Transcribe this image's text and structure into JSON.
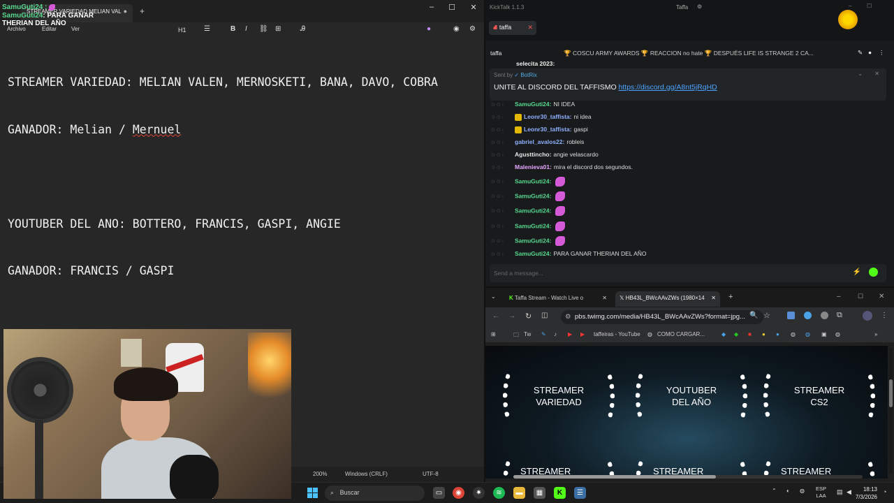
{
  "overlay": {
    "user1": "SamuGuti24 :",
    "user2": "SamuGuti24",
    "msg_part1": ": PARA GANAR",
    "msg_part2": "THERIAN DEL AÑO"
  },
  "notepad": {
    "tab_title": "STREAMER VARIEDAD MELIAN VAL",
    "tab_close": "●",
    "new_tab": "+",
    "menus": [
      "Archivo",
      "Editar",
      "Ver"
    ],
    "toolbar": {
      "heading": "H1",
      "bold": "B",
      "italic": "I"
    },
    "lines": [
      "STREAMER VARIEDAD: MELIAN VALEN, MERNOSKETI, BANA, DAVO, COBRA",
      "GANADOR: Melian / Mernuel",
      "",
      "YOUTUBER DEL ANO: BOTTERO, FRANCIS, GASPI, ANGIE",
      "GANADOR: FRANCIS / GASPI"
    ],
    "line2_prefix": "GANADOR: Melian / ",
    "line2_misspelled": "Mernuel",
    "status": {
      "zoom": "200%",
      "eol": "Windows (CRLF)",
      "encoding": "UTF-8"
    }
  },
  "kicktalk": {
    "app_title": "KickTalk 1.1.3",
    "user": "Taffa",
    "tab_label": "taffa",
    "channel": "taffa",
    "stream_title": "🏆 COSCU ARMY AWARDS 🏆 REACCION no hate 🏆 DESPUÉS LIFE IS STRANGE 2 CA...",
    "pinned": {
      "sent_by": "Sent by",
      "bot_name": "BotRix",
      "text": "UNITE AL DISCORD DEL TAFFISMO ",
      "link": "https://discord.gg/A8nt5jRqHD"
    },
    "top_cut": "selecita  2023:",
    "messages": [
      {
        "user": "SamuGuti24:",
        "text": "NI IDEA",
        "color": "green",
        "badge": false
      },
      {
        "user": "Leonr30_taffista:",
        "text": "ni idea",
        "color": "blue",
        "badge": true
      },
      {
        "user": "Leonr30_taffista:",
        "text": "gaspi",
        "color": "blue",
        "badge": true
      },
      {
        "user": "gabriel_avalos22:",
        "text": "robleis",
        "color": "blue",
        "badge": false
      },
      {
        "user": "Agusttincho:",
        "text": "angie velascardo",
        "color": "white",
        "badge": false
      },
      {
        "user": "Malenieva01:",
        "text": "mira el discord dos segundos.",
        "color": "pink",
        "badge": false
      },
      {
        "user": "SamuGuti24:",
        "text": "",
        "color": "green",
        "badge": false,
        "emote": true
      },
      {
        "user": "SamuGuti24:",
        "text": "",
        "color": "green",
        "badge": false,
        "emote": true
      },
      {
        "user": "SamuGuti24:",
        "text": "",
        "color": "green",
        "badge": false,
        "emote": true
      },
      {
        "user": "SamuGuti24:",
        "text": "",
        "color": "green",
        "badge": false,
        "emote": true
      },
      {
        "user": "SamuGuti24:",
        "text": "",
        "color": "green",
        "badge": false,
        "emote": true
      },
      {
        "user": "SamuGuti24:",
        "text": "PARA GANAR THERIAN DEL AÑO",
        "color": "green",
        "badge": false
      }
    ],
    "input_placeholder": "Send a message..."
  },
  "browser": {
    "tab1": "Taffa Stream - Watch Live o",
    "tab2": "HB43L_BWcAAvZWs (1980×14",
    "url": "pbs.twimg.com/media/HB43L_BWcAAvZWs?format=jpg...",
    "bookmarks": [
      "Tw",
      "taffeiras - YouTube",
      "COMO CARGAR..."
    ],
    "awards": [
      "STREAMER\nVARIEDAD",
      "YOUTUBER\nDEL AÑO",
      "STREAMER\nCS2"
    ],
    "awards_row2": [
      "STREAMER",
      "STREAMER",
      "STREAMER"
    ]
  },
  "taskbar": {
    "search": "Buscar",
    "lang1": "ESP",
    "lang2": "LAA",
    "time": "18:13",
    "date": "7/3/2026"
  },
  "colors": {
    "kick_green": "#53fc18",
    "username_green": "#57d98f",
    "link_blue": "#4da3ff"
  }
}
